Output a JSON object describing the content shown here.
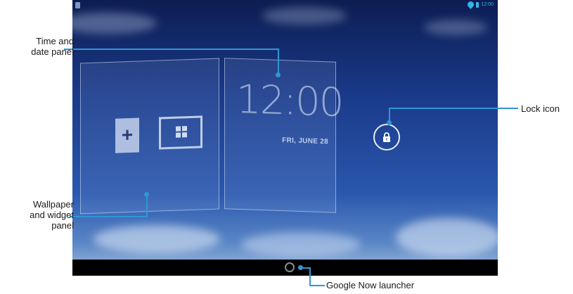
{
  "statusbar": {
    "time": "12:00"
  },
  "lockscreen": {
    "clock_time": "12:00",
    "clock_date": "FRI, JUNE 28",
    "add_label": "+"
  },
  "callouts": {
    "time_date_line1": "Time and",
    "time_date_line2": "date panel",
    "wallpaper_line1": "Wallpaper",
    "wallpaper_line2": "and widget",
    "wallpaper_line3": "panel",
    "lock": "Lock icon",
    "google_now": "Google Now launcher"
  },
  "colors": {
    "callout": "#2e97d6",
    "status_accent": "#33b5e5",
    "sky_dark": "#0d1d52",
    "sky_light": "#a6c0dd"
  }
}
